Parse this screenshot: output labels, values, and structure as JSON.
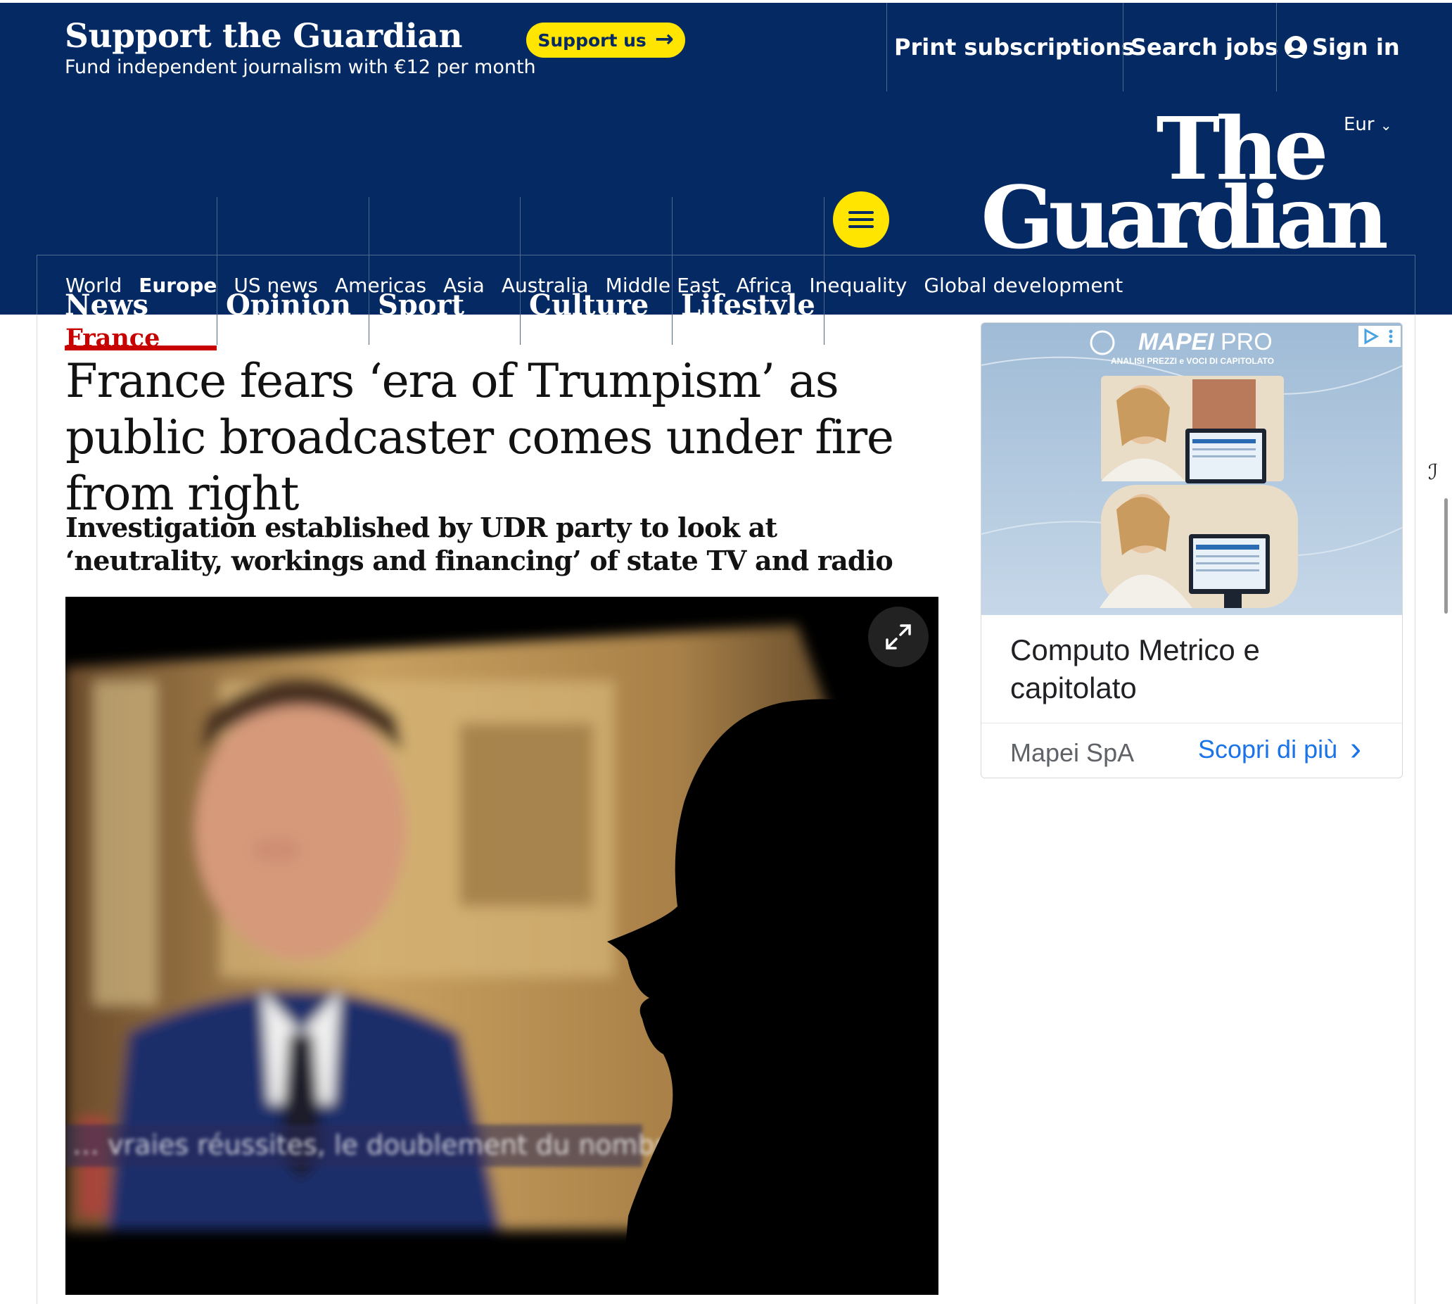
{
  "support": {
    "title": "Support the Guardian",
    "subtitle": "Fund independent journalism with €12 per month",
    "button_label": "Support us",
    "arrow": "→"
  },
  "top_nav": {
    "print": "Print subscriptions",
    "jobs": "Search jobs",
    "signin": "Sign in"
  },
  "masthead": {
    "edition": "Eur",
    "edition_chevron": "⌄",
    "logo_line1": "The",
    "logo_line2": "Guardian"
  },
  "pillars": [
    "News",
    "Opinion",
    "Sport",
    "Culture",
    "Lifestyle"
  ],
  "subnav": [
    "World",
    "Europe",
    "US news",
    "Americas",
    "Asia",
    "Australia",
    "Middle East",
    "Africa",
    "Inequality",
    "Global development"
  ],
  "article": {
    "kicker": "France",
    "headline": "France fears ‘era of Trumpism’ as public broadcaster comes under fire from right",
    "standfirst": "Investigation established by UDR party to look at ‘neutrality, workings and financing’ of state TV and radio",
    "image_caption_overlay": "… vraies réussites, le doublement du nombre …"
  },
  "ad": {
    "brand": "MAPEI",
    "brand_suffix": "PRO",
    "tagline": "ANALISI PREZZI e VOCI DI CAPITOLATO",
    "title": "Computo Metrico e capitolato",
    "advertiser": "Mapei SpA",
    "cta": "Scopri di più",
    "cta_arrow": "›"
  },
  "scroll_mark": "ℐ",
  "colors": {
    "brand_blue": "#052962",
    "support_yellow": "#ffe500",
    "news_red": "#c70000",
    "ad_link_blue": "#1a73e8"
  }
}
